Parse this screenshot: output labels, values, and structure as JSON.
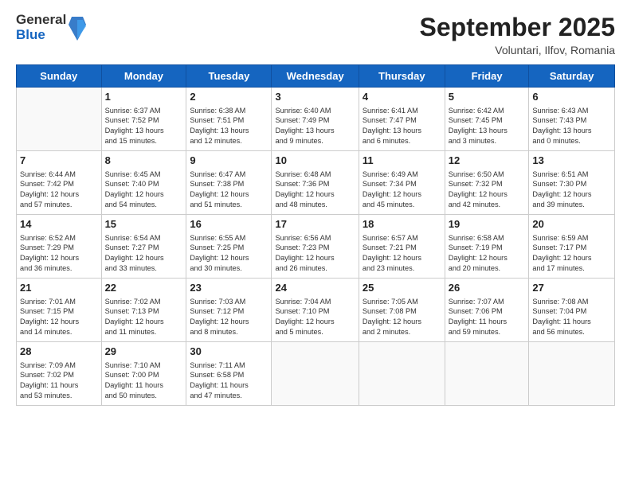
{
  "header": {
    "logo": {
      "line1": "General",
      "line2": "Blue"
    },
    "title": "September 2025",
    "location": "Voluntari, Ilfov, Romania"
  },
  "days_of_week": [
    "Sunday",
    "Monday",
    "Tuesday",
    "Wednesday",
    "Thursday",
    "Friday",
    "Saturday"
  ],
  "weeks": [
    [
      {
        "day": "",
        "info": ""
      },
      {
        "day": "1",
        "info": "Sunrise: 6:37 AM\nSunset: 7:52 PM\nDaylight: 13 hours\nand 15 minutes."
      },
      {
        "day": "2",
        "info": "Sunrise: 6:38 AM\nSunset: 7:51 PM\nDaylight: 13 hours\nand 12 minutes."
      },
      {
        "day": "3",
        "info": "Sunrise: 6:40 AM\nSunset: 7:49 PM\nDaylight: 13 hours\nand 9 minutes."
      },
      {
        "day": "4",
        "info": "Sunrise: 6:41 AM\nSunset: 7:47 PM\nDaylight: 13 hours\nand 6 minutes."
      },
      {
        "day": "5",
        "info": "Sunrise: 6:42 AM\nSunset: 7:45 PM\nDaylight: 13 hours\nand 3 minutes."
      },
      {
        "day": "6",
        "info": "Sunrise: 6:43 AM\nSunset: 7:43 PM\nDaylight: 13 hours\nand 0 minutes."
      }
    ],
    [
      {
        "day": "7",
        "info": "Sunrise: 6:44 AM\nSunset: 7:42 PM\nDaylight: 12 hours\nand 57 minutes."
      },
      {
        "day": "8",
        "info": "Sunrise: 6:45 AM\nSunset: 7:40 PM\nDaylight: 12 hours\nand 54 minutes."
      },
      {
        "day": "9",
        "info": "Sunrise: 6:47 AM\nSunset: 7:38 PM\nDaylight: 12 hours\nand 51 minutes."
      },
      {
        "day": "10",
        "info": "Sunrise: 6:48 AM\nSunset: 7:36 PM\nDaylight: 12 hours\nand 48 minutes."
      },
      {
        "day": "11",
        "info": "Sunrise: 6:49 AM\nSunset: 7:34 PM\nDaylight: 12 hours\nand 45 minutes."
      },
      {
        "day": "12",
        "info": "Sunrise: 6:50 AM\nSunset: 7:32 PM\nDaylight: 12 hours\nand 42 minutes."
      },
      {
        "day": "13",
        "info": "Sunrise: 6:51 AM\nSunset: 7:30 PM\nDaylight: 12 hours\nand 39 minutes."
      }
    ],
    [
      {
        "day": "14",
        "info": "Sunrise: 6:52 AM\nSunset: 7:29 PM\nDaylight: 12 hours\nand 36 minutes."
      },
      {
        "day": "15",
        "info": "Sunrise: 6:54 AM\nSunset: 7:27 PM\nDaylight: 12 hours\nand 33 minutes."
      },
      {
        "day": "16",
        "info": "Sunrise: 6:55 AM\nSunset: 7:25 PM\nDaylight: 12 hours\nand 30 minutes."
      },
      {
        "day": "17",
        "info": "Sunrise: 6:56 AM\nSunset: 7:23 PM\nDaylight: 12 hours\nand 26 minutes."
      },
      {
        "day": "18",
        "info": "Sunrise: 6:57 AM\nSunset: 7:21 PM\nDaylight: 12 hours\nand 23 minutes."
      },
      {
        "day": "19",
        "info": "Sunrise: 6:58 AM\nSunset: 7:19 PM\nDaylight: 12 hours\nand 20 minutes."
      },
      {
        "day": "20",
        "info": "Sunrise: 6:59 AM\nSunset: 7:17 PM\nDaylight: 12 hours\nand 17 minutes."
      }
    ],
    [
      {
        "day": "21",
        "info": "Sunrise: 7:01 AM\nSunset: 7:15 PM\nDaylight: 12 hours\nand 14 minutes."
      },
      {
        "day": "22",
        "info": "Sunrise: 7:02 AM\nSunset: 7:13 PM\nDaylight: 12 hours\nand 11 minutes."
      },
      {
        "day": "23",
        "info": "Sunrise: 7:03 AM\nSunset: 7:12 PM\nDaylight: 12 hours\nand 8 minutes."
      },
      {
        "day": "24",
        "info": "Sunrise: 7:04 AM\nSunset: 7:10 PM\nDaylight: 12 hours\nand 5 minutes."
      },
      {
        "day": "25",
        "info": "Sunrise: 7:05 AM\nSunset: 7:08 PM\nDaylight: 12 hours\nand 2 minutes."
      },
      {
        "day": "26",
        "info": "Sunrise: 7:07 AM\nSunset: 7:06 PM\nDaylight: 11 hours\nand 59 minutes."
      },
      {
        "day": "27",
        "info": "Sunrise: 7:08 AM\nSunset: 7:04 PM\nDaylight: 11 hours\nand 56 minutes."
      }
    ],
    [
      {
        "day": "28",
        "info": "Sunrise: 7:09 AM\nSunset: 7:02 PM\nDaylight: 11 hours\nand 53 minutes."
      },
      {
        "day": "29",
        "info": "Sunrise: 7:10 AM\nSunset: 7:00 PM\nDaylight: 11 hours\nand 50 minutes."
      },
      {
        "day": "30",
        "info": "Sunrise: 7:11 AM\nSunset: 6:58 PM\nDaylight: 11 hours\nand 47 minutes."
      },
      {
        "day": "",
        "info": ""
      },
      {
        "day": "",
        "info": ""
      },
      {
        "day": "",
        "info": ""
      },
      {
        "day": "",
        "info": ""
      }
    ]
  ]
}
